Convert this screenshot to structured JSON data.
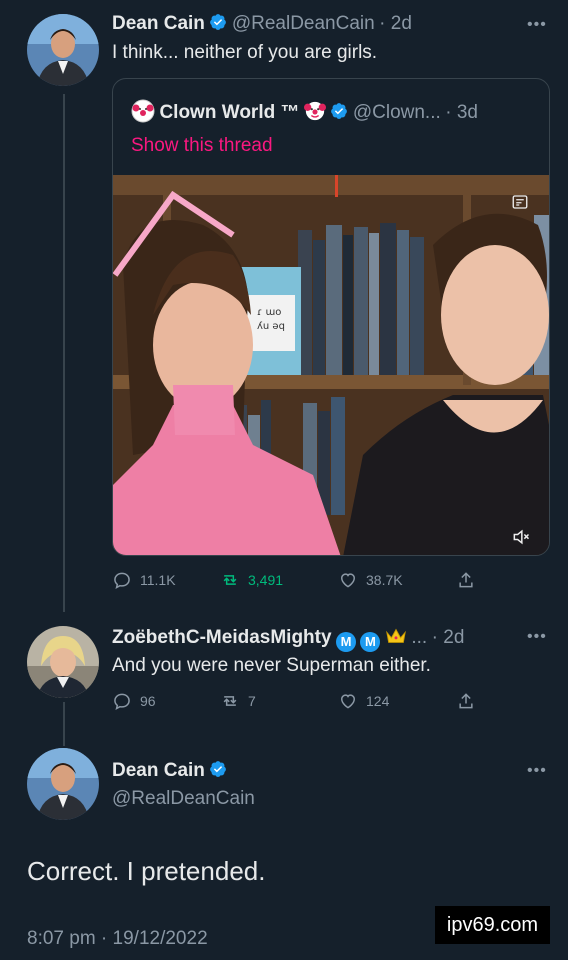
{
  "tweet1": {
    "name": "Dean Cain",
    "handle": "@RealDeanCain",
    "time": "· 2d",
    "text": "I think... neither of you are girls."
  },
  "quote": {
    "name": "Clown World ™",
    "handle": "@Clown...",
    "time": "· 3d",
    "show_thread": "Show this thread",
    "book_text": "ɾ ɯo\nʎu ǝq\nʎ",
    "icons": [
      "clown-emoji-icon",
      "verified-icon",
      "mute-icon",
      "gif-ratio-icon"
    ]
  },
  "actions1": {
    "replies": "11.1K",
    "retweets": "3,491",
    "likes": "38.7K"
  },
  "reply": {
    "name": "ZoëbethC-MeidasMighty",
    "badge_m": "M",
    "suffix": "...",
    "time": "· 2d",
    "text": "And you were never Superman either."
  },
  "actions2": {
    "replies": "96",
    "retweets": "7",
    "likes": "124"
  },
  "tweet2": {
    "name": "Dean Cain",
    "handle": "@RealDeanCain",
    "text": "Correct. I pretended.",
    "timestamp": "8:07 pm · 19/12/2022"
  },
  "more_label": "•••",
  "watermark": "ipv69.com",
  "colors": {
    "bg": "#15202b",
    "accent": "#1d9bf0",
    "pink": "#f91880",
    "green": "#00ba7c",
    "muted": "#8b98a5"
  }
}
